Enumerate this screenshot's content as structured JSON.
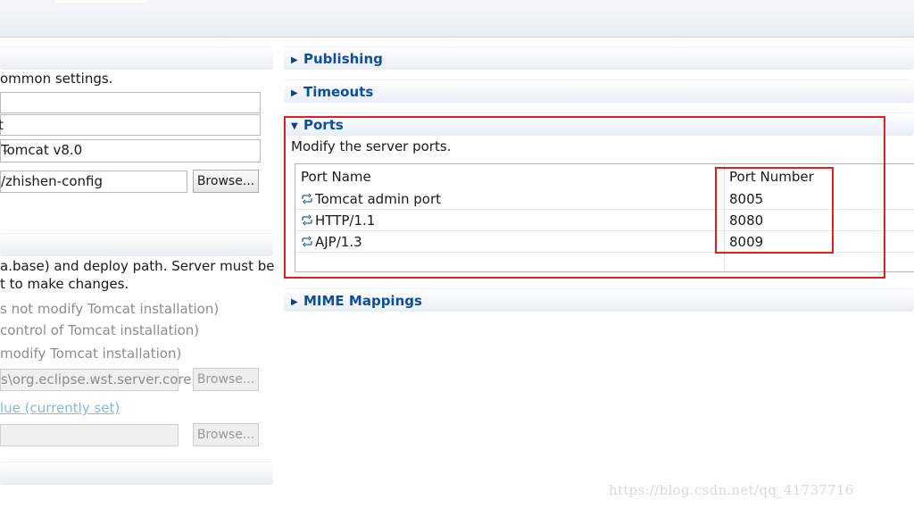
{
  "left": {
    "general_desc": "ommon settings.",
    "field_runtime": "Tomcat v8.0",
    "field_config": "/zhishen-config",
    "browse": "Browse...",
    "desc_line1": "a.base) and deploy path. Server must be",
    "desc_line2": "t to make changes.",
    "opt1": "s not modify Tomcat installation)",
    "opt2": "control of Tomcat installation)",
    "opt3": "modify Tomcat installation)",
    "path_field": "s\\org.eclipse.wst.server.core",
    "link": "lue (currently set)"
  },
  "sections": {
    "publishing": "Publishing",
    "timeouts": "Timeouts",
    "ports": "Ports",
    "mime": "MIME Mappings"
  },
  "ports": {
    "description": "Modify the server ports.",
    "columns": [
      "Port Name",
      "Port Number"
    ],
    "rows": [
      {
        "name": "Tomcat admin port",
        "number": "8005"
      },
      {
        "name": "HTTP/1.1",
        "number": "8080"
      },
      {
        "name": "AJP/1.3",
        "number": "8009"
      }
    ]
  },
  "watermark": "https://blog.csdn.net/qq_41737716",
  "colors": {
    "section_title": "#0e4e9e",
    "highlight": "#e02020",
    "link": "#86b7e8"
  },
  "icons": {
    "port": "port-icon",
    "expanded": "triangle-down-icon",
    "collapsed": "triangle-right-icon"
  }
}
